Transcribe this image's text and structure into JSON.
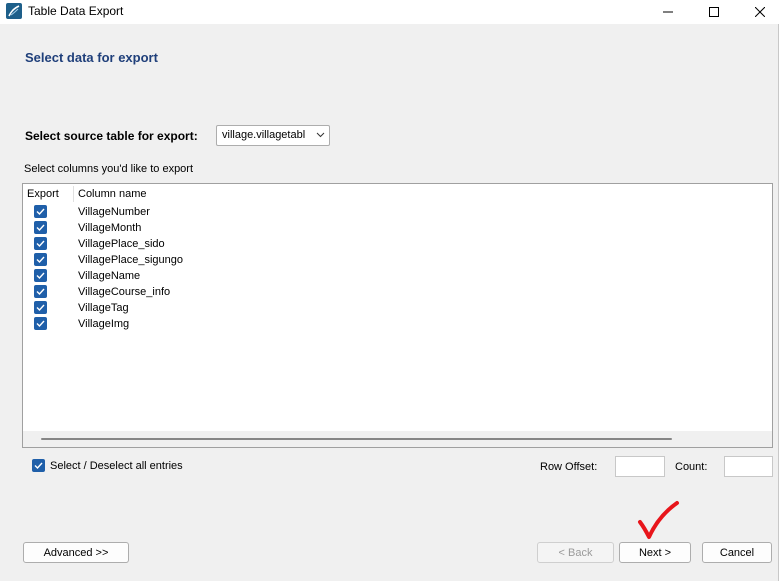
{
  "window": {
    "title": "Table Data Export"
  },
  "page": {
    "heading": "Select data for export"
  },
  "source": {
    "label": "Select source table for export:",
    "selected_table": "village.villagetabl"
  },
  "columns": {
    "label": "Select columns you'd like to export",
    "header_export": "Export",
    "header_column_name": "Column name",
    "items": [
      {
        "name": "VillageNumber",
        "checked": true
      },
      {
        "name": "VillageMonth",
        "checked": true
      },
      {
        "name": "VillagePlace_sido",
        "checked": true
      },
      {
        "name": "VillagePlace_sigungo",
        "checked": true
      },
      {
        "name": "VillageName",
        "checked": true
      },
      {
        "name": "VillageCourse_info",
        "checked": true
      },
      {
        "name": "VillageTag",
        "checked": true
      },
      {
        "name": "VillageImg",
        "checked": true
      }
    ]
  },
  "options": {
    "select_all_label": "Select / Deselect all entries",
    "select_all_checked": true,
    "row_offset_label": "Row Offset:",
    "row_offset_value": "",
    "count_label": "Count:",
    "count_value": ""
  },
  "buttons": {
    "advanced": "Advanced >>",
    "back": "< Back",
    "next": "Next >",
    "cancel": "Cancel"
  },
  "colors": {
    "heading": "#1f3f7a",
    "checkbox": "#1f5fa9",
    "annotation_check": "#e8151b"
  },
  "icons": {
    "app": "mysql-workbench-icon",
    "minimize": "minimize-icon",
    "maximize": "maximize-icon",
    "close": "close-icon",
    "dropdown": "chevron-down-icon",
    "annotation": "red-checkmark-icon"
  }
}
